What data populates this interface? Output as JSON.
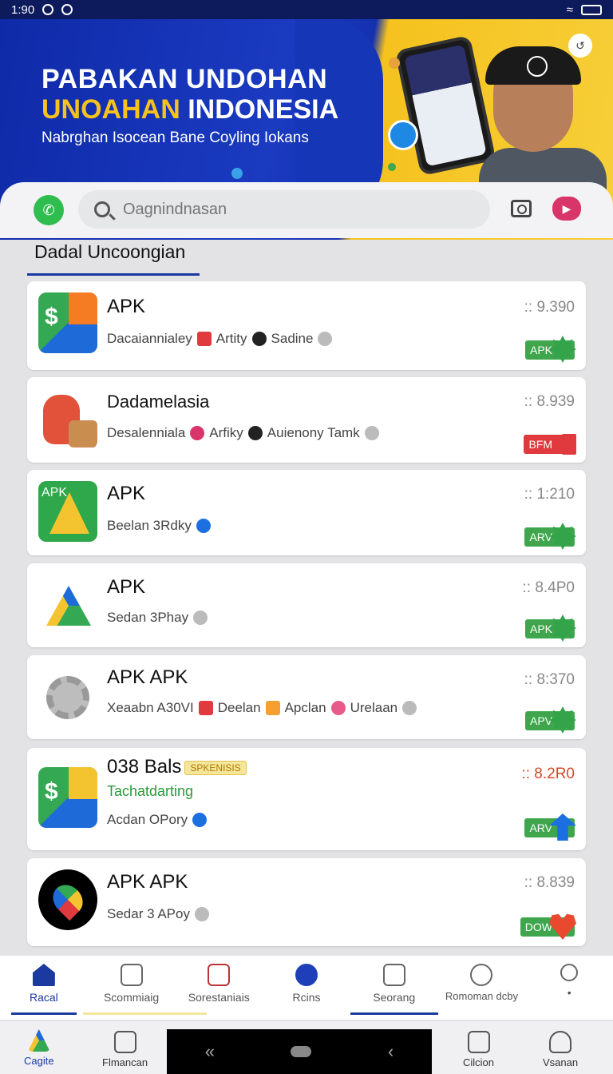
{
  "status": {
    "time": "1:90"
  },
  "banner": {
    "line1": "PABAKAN UNDOHAN",
    "line2_highlight": "UNOAHAN",
    "line2_rest": " INDONESIA",
    "subtitle": "Nabrghan Isocean Bane Coyling Iokans"
  },
  "search": {
    "placeholder": "Oagnindnasan"
  },
  "section": {
    "title": "Dadal Uncoongian"
  },
  "cards": [
    {
      "title": "APK",
      "meta": [
        "Dacaiannialey",
        "Artity",
        "Sadine"
      ],
      "rank": ":: 9.390",
      "button": "APK"
    },
    {
      "title": "Dadamelasia",
      "meta": [
        "Desalenniala",
        "Arfiky",
        "Auienony Tamk"
      ],
      "rank": ":: 8.939",
      "button": "BFM"
    },
    {
      "title": "APK",
      "meta": [
        "Beelan 3Rdky"
      ],
      "rank": ":: 1:210",
      "button": "ARV"
    },
    {
      "title": "APK",
      "meta": [
        "Sedan 3Phay"
      ],
      "rank": ":: 8.4P0",
      "button": "APK"
    },
    {
      "title": "APK APK",
      "meta": [
        "Xeaabn A30VI",
        "Deelan",
        "Apclan",
        "Urelaan"
      ],
      "rank": ":: 8:370",
      "button": "APV"
    },
    {
      "title": "038 Bals",
      "tag": "SPKENISIS",
      "subtitle": "Tachatdarting",
      "meta": [
        "Acdan OPory"
      ],
      "rank": ":: 8.2R0",
      "button": "ARV"
    },
    {
      "title": "APK APK",
      "meta": [
        "Sedar 3 APoy"
      ],
      "rank": ":: 8.839",
      "button": "DOW"
    }
  ],
  "bottomnav": [
    {
      "label": "Racal"
    },
    {
      "label": "Scommiaig"
    },
    {
      "label": "Sorestaniais"
    },
    {
      "label": "Rcins"
    },
    {
      "label": "Seorang"
    },
    {
      "label": "Romoman dcby"
    },
    {
      "label": "•"
    }
  ],
  "sysnav": [
    {
      "label": "Cagite"
    },
    {
      "label": "Flmancan"
    },
    {
      "label": "Cilcion"
    },
    {
      "label": "Vsanan"
    }
  ],
  "colors": {
    "primary": "#1a3aa0",
    "accent_yellow": "#f5c21e",
    "download_green": "#3fa64e"
  }
}
